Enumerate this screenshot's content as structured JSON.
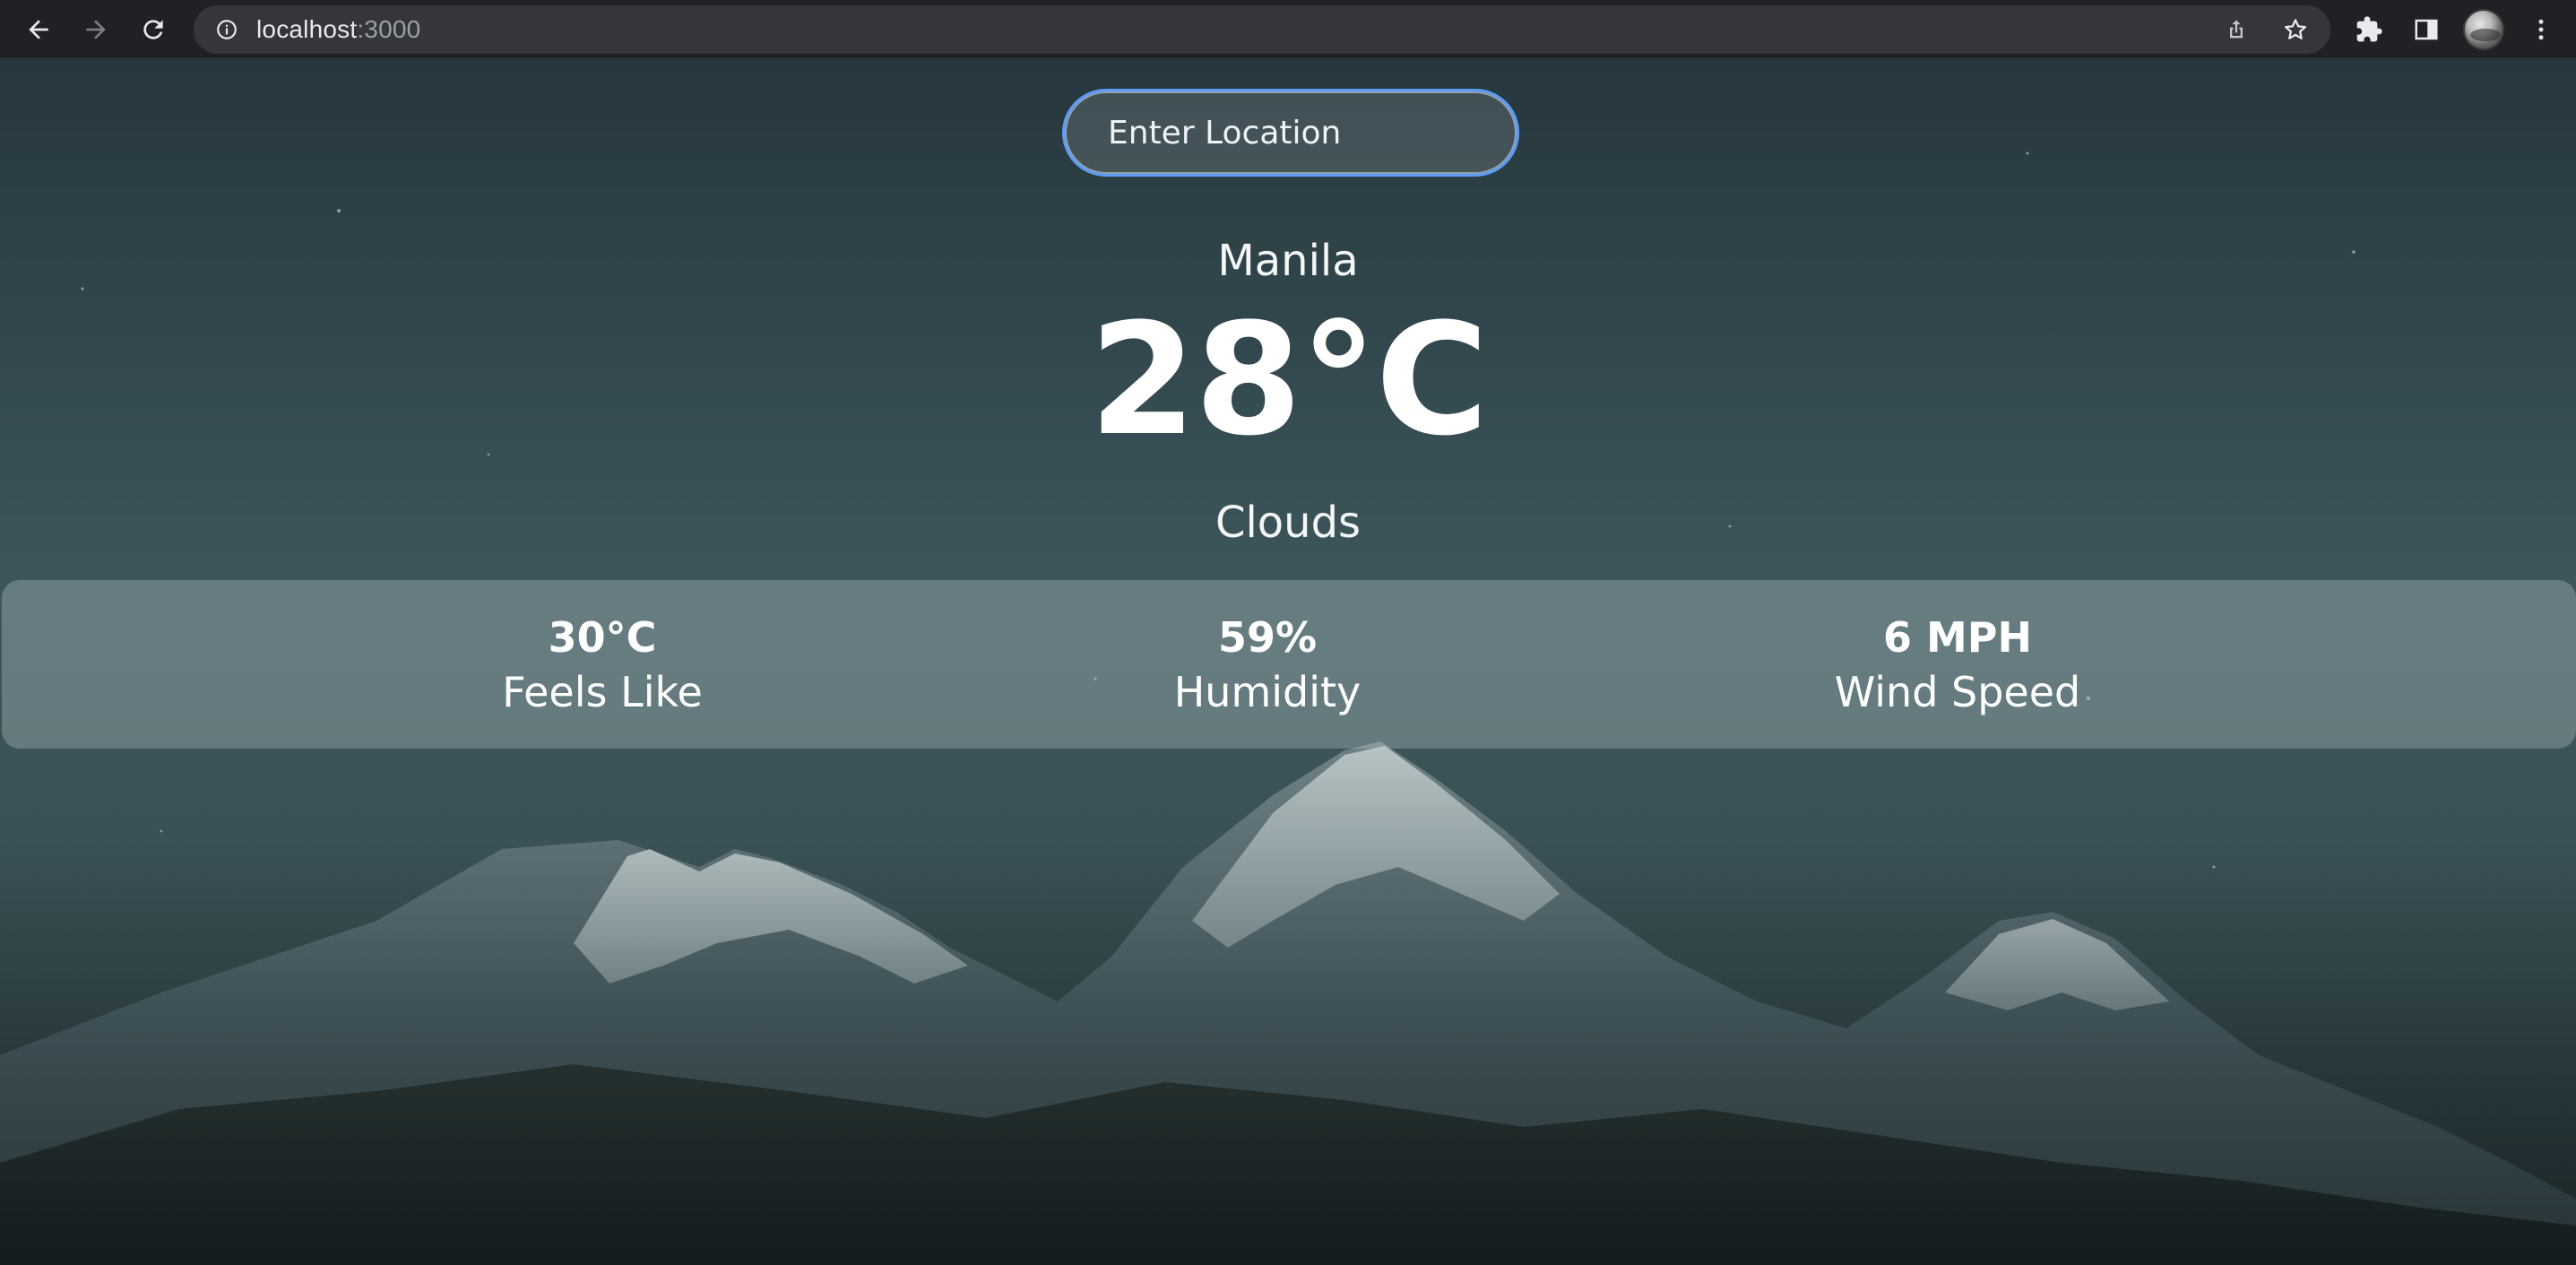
{
  "browser": {
    "url_host": "localhost",
    "url_port": ":3000"
  },
  "search": {
    "placeholder": "Enter Location",
    "value": ""
  },
  "weather": {
    "location": "Manila",
    "temperature": "28°C",
    "condition": "Clouds"
  },
  "stats": [
    {
      "value": "30°C",
      "label": "Feels Like"
    },
    {
      "value": "59%",
      "label": "Humidity"
    },
    {
      "value": "6 MPH",
      "label": "Wind Speed"
    }
  ],
  "colors": {
    "chrome_bar": "#202124",
    "omnibox": "#35363a",
    "input_focus_ring": "#5b9df9",
    "text": "#ffffff"
  },
  "icons": {
    "back": "arrow-left-icon",
    "forward": "arrow-right-icon",
    "reload": "reload-icon",
    "site_info": "info-icon",
    "share": "share-icon",
    "bookmark": "star-icon",
    "extensions": "puzzle-icon",
    "side_panel": "side-panel-icon",
    "menu": "kebab-menu-icon"
  }
}
